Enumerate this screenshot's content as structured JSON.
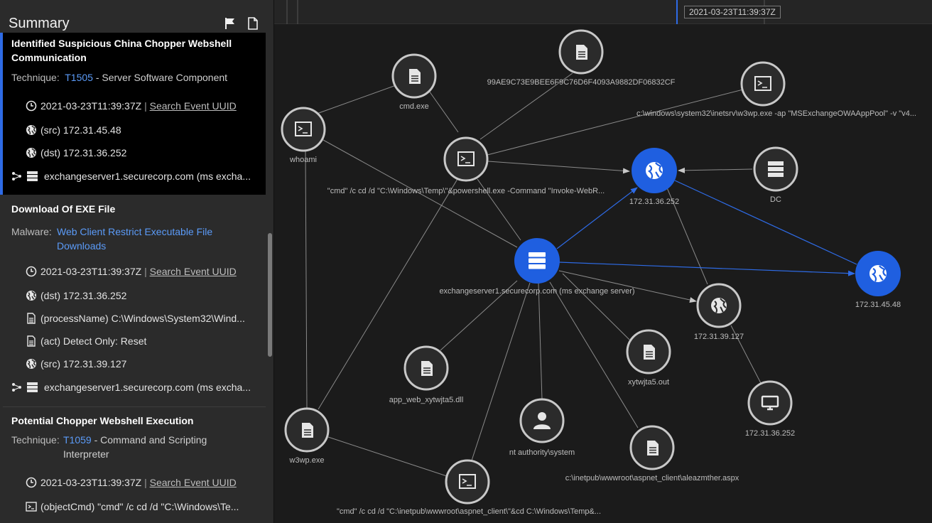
{
  "sidebar": {
    "title": "Summary",
    "cards": [
      {
        "title": "Identified Suspicious China Chopper Webshell Communication",
        "technique_label": "Technique:",
        "technique_id": "T1505",
        "technique_name": "- Server Software Component",
        "time": "2021-03-23T11:39:37Z",
        "separator": "|",
        "search_link": "Search Event UUID",
        "src": "(src)  172.31.45.48",
        "dst": "(dst)  172.31.36.252",
        "host": "exchangeserver1.securecorp.com (ms excha..."
      },
      {
        "title": "Download Of EXE File",
        "malware_label": "Malware:",
        "malware_line1": "Web Client Restrict Executable File",
        "malware_line2": "Downloads",
        "time": "2021-03-23T11:39:37Z",
        "separator": "|",
        "search_link": "Search Event UUID",
        "dst": "(dst)  172.31.36.252",
        "process": "(processName)  C:\\Windows\\System32\\Wind...",
        "act": "(act)  Detect Only: Reset",
        "src": "(src)  172.31.39.127",
        "host": "exchangeserver1.securecorp.com (ms excha..."
      },
      {
        "title": "Potential Chopper Webshell Execution",
        "technique_label": "Technique:",
        "technique_id": "T1059",
        "technique_name_line1": "- Command and Scripting",
        "technique_name_line2": "Interpreter",
        "time": "2021-03-23T11:39:37Z",
        "separator": "|",
        "search_link": "Search Event UUID",
        "objectcmd": "(objectCmd)  \"cmd\" /c cd /d \"C:\\Windows\\Te..."
      }
    ]
  },
  "timeline": {
    "timestamp": "2021-03-23T11:39:37Z"
  },
  "graph": {
    "nodes": [
      {
        "id": "hash",
        "icon": "file-icon",
        "label": "99AE9C73E9BEE6F9C76D6F4093A9882DF06832CF"
      },
      {
        "id": "cmdexe",
        "icon": "file-icon",
        "label": "cmd.exe"
      },
      {
        "id": "whoami",
        "icon": "terminal-icon",
        "label": "whoami"
      },
      {
        "id": "w3wpcmd",
        "icon": "terminal-icon",
        "label": "c:\\windows\\system32\\inetsrv\\w3wp.exe -ap \"MSExchangeOWAAppPool\" -v \"v4..."
      },
      {
        "id": "pscmd",
        "icon": "terminal-icon",
        "label": "\"cmd\" /c cd /d \"C:\\Windows\\Temp\\\"&powershell.exe -Command \"Invoke-WebR..."
      },
      {
        "id": "ip252",
        "icon": "globe-icon",
        "label": "172.31.36.252"
      },
      {
        "id": "dc",
        "icon": "server-icon",
        "label": "DC"
      },
      {
        "id": "exch",
        "icon": "server-icon",
        "label": "exchangeserver1.securecorp.com (ms exchange server)"
      },
      {
        "id": "ip4548",
        "icon": "globe-icon",
        "label": "172.31.45.48"
      },
      {
        "id": "ip39127",
        "icon": "globe-icon",
        "label": "172.31.39.127"
      },
      {
        "id": "dll",
        "icon": "file-icon",
        "label": "app_web_xytwjta5.dll"
      },
      {
        "id": "out",
        "icon": "file-icon",
        "label": "xytwjta5.out"
      },
      {
        "id": "ntauth",
        "icon": "user-icon",
        "label": "nt authority\\system"
      },
      {
        "id": "ipmon",
        "icon": "monitor-icon",
        "label": "172.31.36.252"
      },
      {
        "id": "w3wp",
        "icon": "file-icon",
        "label": "w3wp.exe"
      },
      {
        "id": "aspx",
        "icon": "file-icon",
        "label": "c:\\inetpub\\wwwroot\\aspnet_client\\aleazmther.aspx"
      },
      {
        "id": "cmd2",
        "icon": "terminal-icon",
        "label": "\"cmd\" /c cd /d \"C:\\inetpub\\wwwroot\\aspnet_client\\\"&cd C:\\Windows\\Temp&..."
      }
    ]
  },
  "colors": {
    "accent": "#2e6be6",
    "node_blue": "#1f5fe0",
    "node_dark": "#2b2b2b",
    "edge": "#8a8a8a",
    "link": "#5b9bf8"
  }
}
